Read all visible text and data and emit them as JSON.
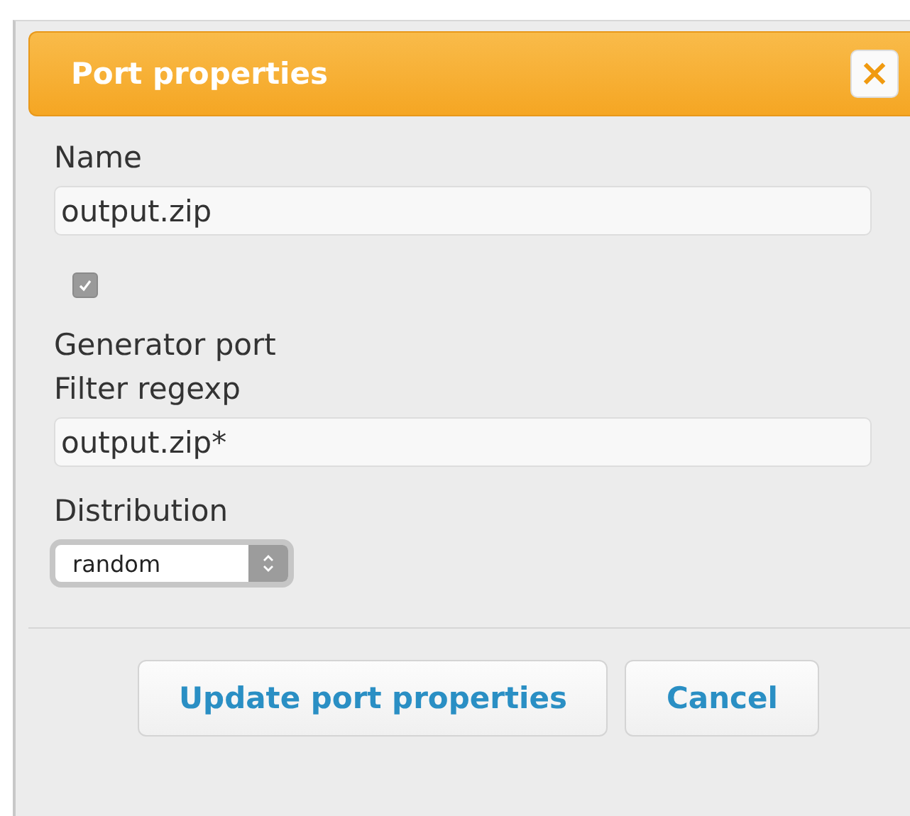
{
  "dialog": {
    "title": "Port properties",
    "close_icon": "×"
  },
  "fields": [
    {
      "kind": "text",
      "label": "Name",
      "value": "output.zip"
    },
    {
      "kind": "checkbox",
      "checked": true,
      "disabled": true,
      "label": "Generator port"
    },
    {
      "kind": "text",
      "label": "Filter regexp",
      "value": "output.zip*"
    },
    {
      "kind": "select",
      "label": "Distribution",
      "value": "random"
    }
  ],
  "buttons": [
    {
      "label": "Update port properties"
    },
    {
      "label": "Cancel"
    }
  ]
}
